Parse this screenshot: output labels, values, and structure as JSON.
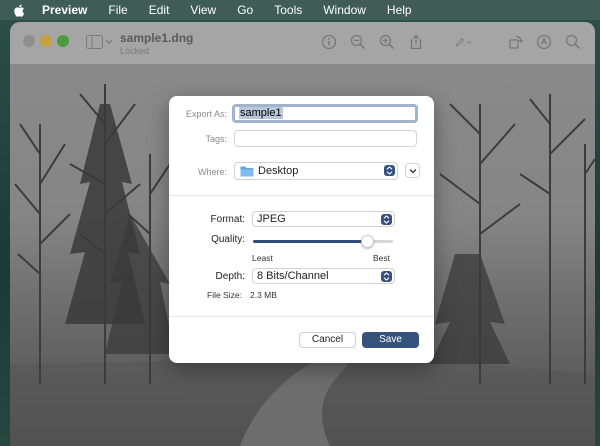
{
  "menubar": {
    "items": [
      "Preview",
      "File",
      "Edit",
      "View",
      "Go",
      "Tools",
      "Window",
      "Help"
    ]
  },
  "window": {
    "title": "sample1.dng",
    "subtitle": "Locked"
  },
  "icons": [
    "apple-icon",
    "sidebar-icon",
    "info-icon",
    "zoom-out-icon",
    "zoom-in-icon",
    "share-icon",
    "markup-icon",
    "rotate-icon",
    "annotate-icon",
    "search-icon"
  ],
  "export_dialog": {
    "export_as_label": "Export As:",
    "export_as_value": "sample1",
    "tags_label": "Tags:",
    "tags_value": "",
    "where_label": "Where:",
    "where_value": "Desktop",
    "format_label": "Format:",
    "format_value": "JPEG",
    "quality_label": "Quality:",
    "quality_level": 0.82,
    "quality_min_label": "Least",
    "quality_max_label": "Best",
    "depth_label": "Depth:",
    "depth_value": "8 Bits/Channel",
    "filesize_label": "File Size:",
    "filesize_value": "2.3 MB",
    "cancel_label": "Cancel",
    "save_label": "Save"
  },
  "colors": {
    "accent": "#36537c",
    "menubar": "#3f5c56",
    "sheet_bg": "#ffffff"
  }
}
